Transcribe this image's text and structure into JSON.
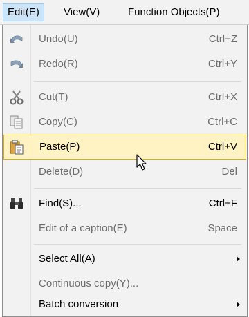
{
  "menubar": {
    "items": [
      {
        "label": "Edit(E)"
      },
      {
        "label": "View(V)"
      },
      {
        "label": "Function Objects(P)"
      }
    ]
  },
  "edit_menu": {
    "items": [
      {
        "label": "Undo(U)",
        "shortcut": "Ctrl+Z",
        "icon": "undo-icon",
        "enabled": false
      },
      {
        "label": "Redo(R)",
        "shortcut": "Ctrl+Y",
        "icon": "redo-icon",
        "enabled": false
      },
      {
        "label": "Cut(T)",
        "shortcut": "Ctrl+X",
        "icon": "scissors-icon",
        "enabled": false
      },
      {
        "label": "Copy(C)",
        "shortcut": "Ctrl+C",
        "icon": "copy-icon",
        "enabled": false
      },
      {
        "label": "Paste(P)",
        "shortcut": "Ctrl+V",
        "icon": "paste-icon",
        "enabled": true,
        "highlighted": true
      },
      {
        "label": "Delete(D)",
        "shortcut": "Del",
        "enabled": false
      },
      {
        "label": "Find(S)...",
        "shortcut": "Ctrl+F",
        "icon": "binoculars-icon",
        "enabled": true
      },
      {
        "label": "Edit of a caption(E)",
        "shortcut": "Space",
        "enabled": false
      },
      {
        "label": "Select All(A)",
        "submenu": true,
        "enabled": true
      },
      {
        "label": "Continuous copy(Y)...",
        "enabled": false
      },
      {
        "label": "Batch conversion",
        "submenu": true,
        "enabled": true
      }
    ]
  },
  "colors": {
    "highlight_bg": "#fff3c4",
    "highlight_border": "#e0b000",
    "active_menu_bg": "#cce4f7",
    "disabled_text": "#6d6d6d"
  }
}
